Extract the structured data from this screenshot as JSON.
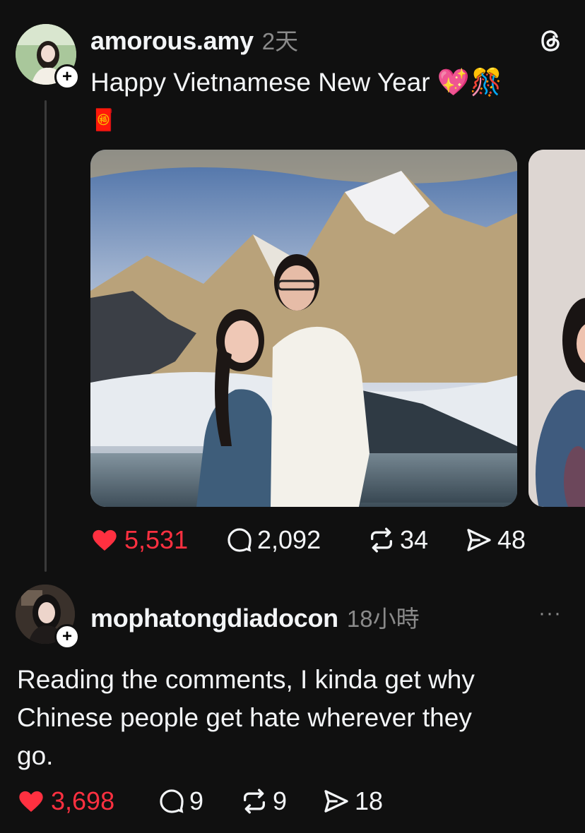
{
  "post": {
    "username": "amorous.amy",
    "time": "2天",
    "text_line1": "Happy Vietnamese New Year 💖🎊",
    "text_line2": "🧧",
    "actions": {
      "likes": "5,531",
      "comments": "2,092",
      "reposts": "34",
      "shares": "48"
    }
  },
  "reply": {
    "username": "mophatongdiadocon",
    "time": "18小時",
    "more": "···",
    "text": [
      "Reading the comments, I kinda get why",
      "Chinese people get hate wherever they",
      "go."
    ],
    "actions": {
      "likes": "3,698",
      "comments": "9",
      "reposts": "9",
      "shares": "18"
    }
  },
  "colors": {
    "background": "#101010",
    "like": "#ff3040",
    "muted": "#8a8a8a"
  }
}
